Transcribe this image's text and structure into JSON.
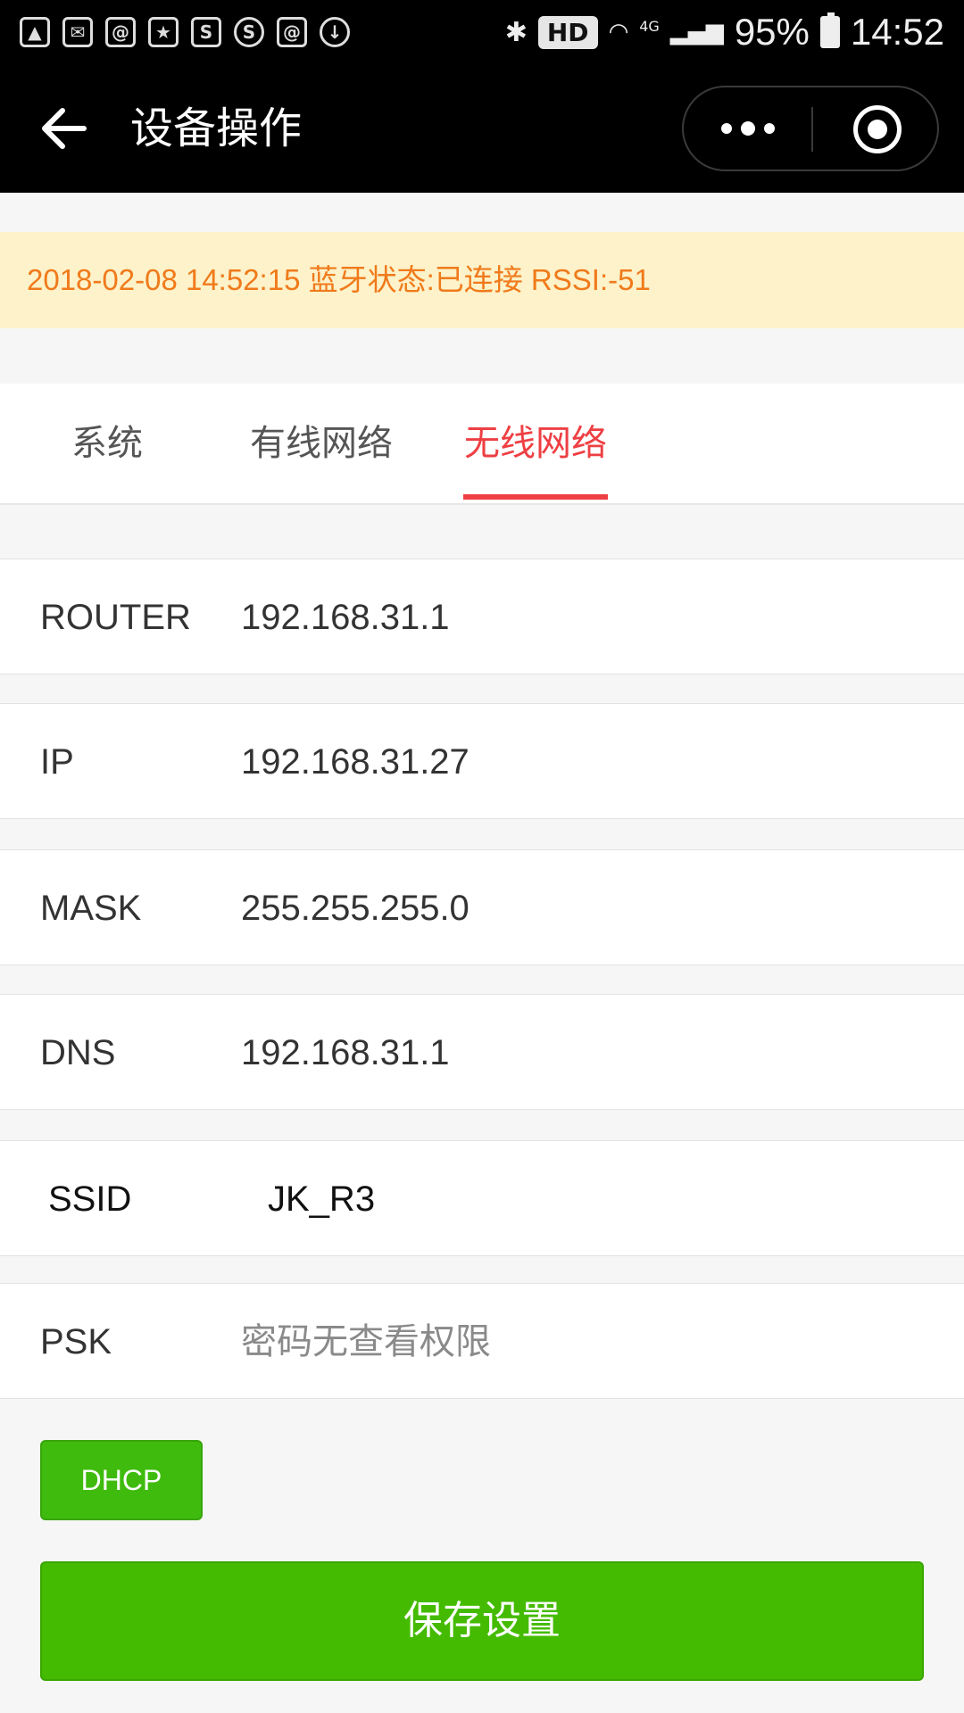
{
  "status_bar": {
    "left_icons": [
      "gallery-icon",
      "mail-icon",
      "at-mail-icon",
      "calendar-icon",
      "s-app-icon",
      "weibo-icon",
      "message-icon",
      "download-icon"
    ],
    "right_icons": [
      "bluetooth-icon",
      "hd-icon",
      "wifi-icon",
      "signal-icon",
      "battery-icon"
    ],
    "hd_label": "HD",
    "network_type": "4G",
    "battery": "95%",
    "time": "14:52"
  },
  "navbar": {
    "title": "设备操作"
  },
  "banner": {
    "text": "2018-02-08 14:52:15 蓝牙状态:已连接 RSSI:-51",
    "color": "#f07a1b",
    "background": "#fdf2c9"
  },
  "tabs": [
    {
      "label": "系统",
      "active": false
    },
    {
      "label": "有线网络",
      "active": false
    },
    {
      "label": "无线网络",
      "active": true
    }
  ],
  "accent_color": "#ee3f43",
  "fields": {
    "router": {
      "label": "ROUTER",
      "value": "192.168.31.1"
    },
    "ip": {
      "label": "IP",
      "value": "192.168.31.27"
    },
    "mask": {
      "label": "MASK",
      "value": "255.255.255.0"
    },
    "dns": {
      "label": "DNS",
      "value": "192.168.31.1"
    },
    "ssid": {
      "label": "SSID",
      "value": "JK_R3"
    },
    "psk": {
      "label": "PSK",
      "value": "",
      "placeholder": "密码无查看权限"
    }
  },
  "buttons": {
    "dhcp": "DHCP",
    "save": "保存设置",
    "color": "#44bb00"
  }
}
